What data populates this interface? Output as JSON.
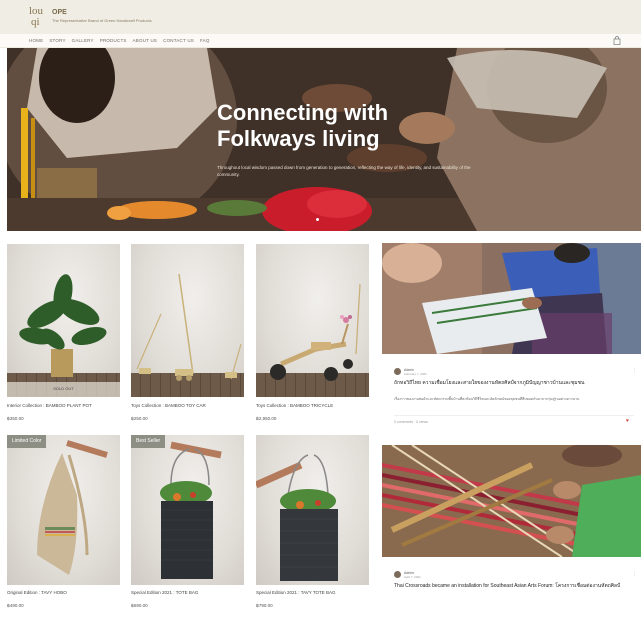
{
  "header": {
    "logo_line1": "lou",
    "logo_line2": "qi",
    "brand": "OPE",
    "tagline": "The Representative Brand of Green Handicraft Products",
    "nav": [
      "HOME",
      "STORY",
      "GALLERY",
      "PRODUCTS",
      "ABOUT US",
      "CONTACT US",
      "FAQ"
    ],
    "cart_icon": "shopping-bag-icon"
  },
  "hero": {
    "title_line1": "Connecting with",
    "title_line2": "Folkways living",
    "subtitle": "Throughout local wisdom passed down from generation to generation, reflecting the way of life, identity, and sustainability of the community."
  },
  "products": [
    {
      "name": "Interior Collection : BAMBOO PLANT POT",
      "price": "฿350.00",
      "badge": "",
      "overlay": "SOLD OUT"
    },
    {
      "name": "Toys Collection : BAMBOO TOY CAR",
      "price": "฿250.00",
      "badge": "",
      "overlay": ""
    },
    {
      "name": "Toys Collection : BAMBOO TRICYCLE",
      "price": "฿2,950.00",
      "badge": "",
      "overlay": ""
    },
    {
      "name": "Original Edition : TAVY HOBO",
      "price": "฿490.00",
      "badge": "Limited Color",
      "overlay": ""
    },
    {
      "name": "Special Edition 2021 : TOTE BAG",
      "price": "฿690.00",
      "badge": "Best Seller",
      "overlay": ""
    },
    {
      "name": "Special Edition 2021 : TAVY TOTE BAG",
      "price": "฿790.00",
      "badge": "",
      "overlay": ""
    }
  ],
  "blog": [
    {
      "author": "Admin",
      "date": "February 7, 2021",
      "title": "ถักทอวิถีไทย ความเชื่อมโยงและสายใยของงานหัตถศิลป์จากภูมิปัญญาชาวบ้านและชุมชน",
      "excerpt": "เรื่องราวของงานทอผ้าและหัตถกรรมพื้นบ้านที่สะท้อนวิถีชีวิตและอัตลักษณ์ของชุมชนที่สืบทอดกันมาจากรุ่นสู่รุ่นอย่างยาวนาน",
      "footer": "0 comments · 0 views"
    },
    {
      "author": "Admin",
      "date": "April 7, 2021",
      "title": "Thai Crossroads became an installation for Southeast Asian Arts Forum: โครงการเชื่อมต่องานหัตถศิลป์",
      "excerpt": "",
      "footer": ""
    }
  ],
  "colors": {
    "header_bg": "#efede4",
    "badge_bg": "#8e8f84",
    "heart": "#d23a3a"
  }
}
